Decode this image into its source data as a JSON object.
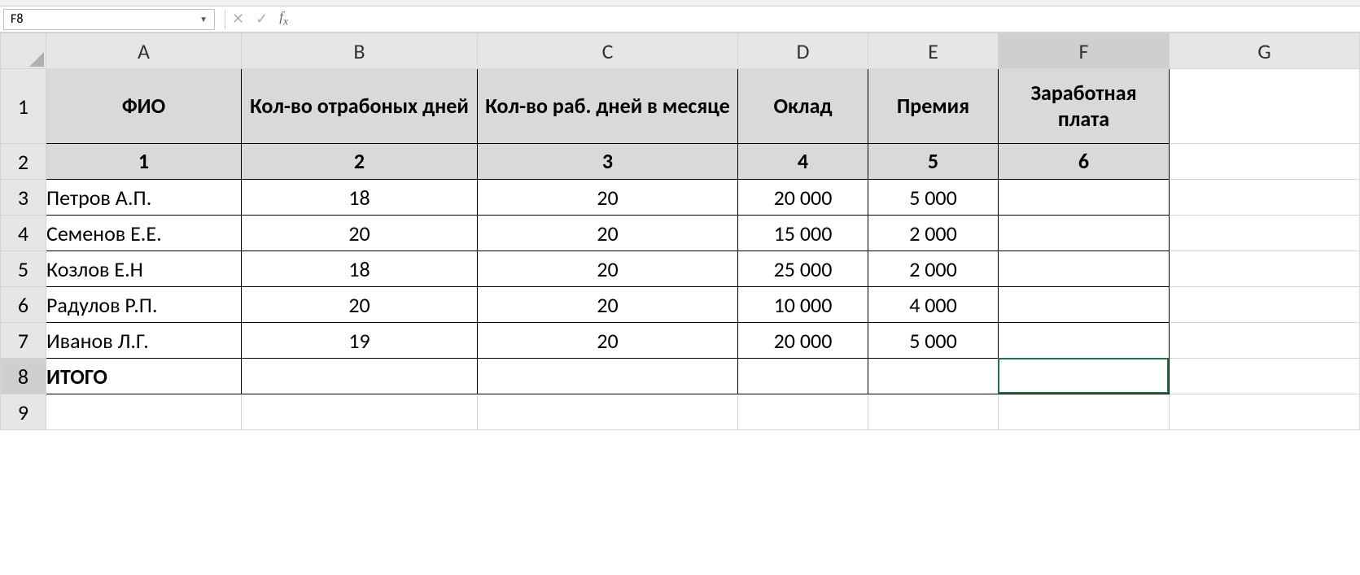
{
  "nameBox": "F8",
  "formulaBar": "",
  "columnLetters": [
    "A",
    "B",
    "C",
    "D",
    "E",
    "F",
    "G"
  ],
  "rowNumbers": [
    "1",
    "2",
    "3",
    "4",
    "5",
    "6",
    "7",
    "8",
    "9"
  ],
  "headers": {
    "row1": [
      "ФИО",
      "Кол-во отрабоных дней",
      "Кол-во раб. дней в месяце",
      "Оклад",
      "Премия",
      "Заработная плата"
    ],
    "row2": [
      "1",
      "2",
      "3",
      "4",
      "5",
      "6"
    ]
  },
  "dataRows": [
    {
      "a": "Петров А.П.",
      "b": "18",
      "c": "20",
      "d": "20 000",
      "e": "5 000",
      "f": ""
    },
    {
      "a": "Семенов Е.Е.",
      "b": "20",
      "c": "20",
      "d": "15 000",
      "e": "2 000",
      "f": ""
    },
    {
      "a": "Козлов Е.Н",
      "b": "18",
      "c": "20",
      "d": "25 000",
      "e": "2 000",
      "f": ""
    },
    {
      "a": "Радулов Р.П.",
      "b": "20",
      "c": "20",
      "d": "10 000",
      "e": "4 000",
      "f": ""
    },
    {
      "a": "Иванов Л.Г.",
      "b": "19",
      "c": "20",
      "d": "20 000",
      "e": "5 000",
      "f": ""
    }
  ],
  "totalRow": {
    "a": "ИТОГО",
    "b": "",
    "c": "",
    "d": "",
    "e": "",
    "f": ""
  },
  "selectedCell": {
    "row": 8,
    "col": "F"
  },
  "chart_data": {
    "type": "table",
    "title": "Payroll table",
    "columns": [
      "ФИО",
      "Кол-во отрабоных дней",
      "Кол-во раб. дней в месяце",
      "Оклад",
      "Премия",
      "Заработная плата"
    ],
    "rows": [
      [
        "Петров А.П.",
        18,
        20,
        20000,
        5000,
        null
      ],
      [
        "Семенов Е.Е.",
        20,
        20,
        15000,
        2000,
        null
      ],
      [
        "Козлов Е.Н",
        18,
        20,
        25000,
        2000,
        null
      ],
      [
        "Радулов Р.П.",
        20,
        20,
        10000,
        4000,
        null
      ],
      [
        "Иванов Л.Г.",
        19,
        20,
        20000,
        5000,
        null
      ]
    ]
  }
}
